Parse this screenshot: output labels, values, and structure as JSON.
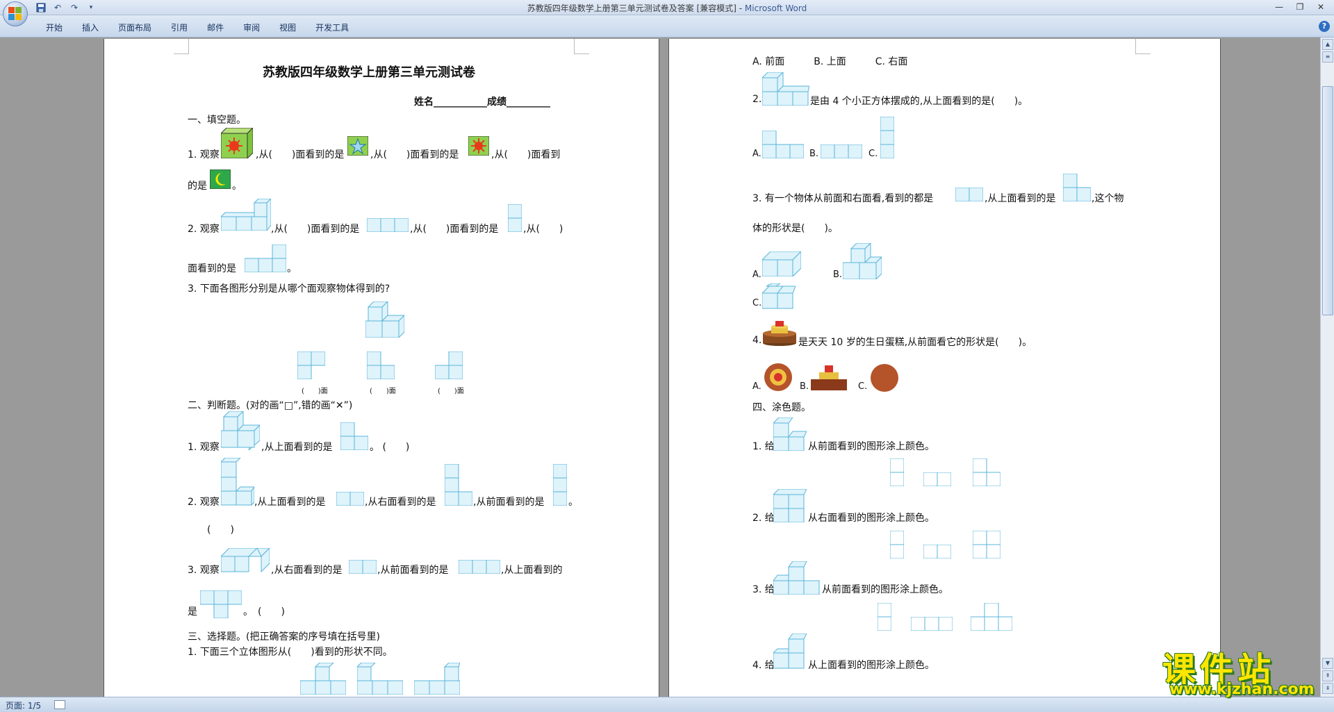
{
  "window": {
    "title_doc": "苏教版四年级数学上册第三单元测试卷及答案 [兼容模式] - ",
    "title_app": "Microsoft Word"
  },
  "ribbon": {
    "tabs": [
      "开始",
      "插入",
      "页面布局",
      "引用",
      "邮件",
      "审阅",
      "视图",
      "开发工具"
    ]
  },
  "status": {
    "page": "页面: 1/5"
  },
  "watermark": {
    "brand": "课件站",
    "url": "www.kjzhan.com"
  },
  "colors": {
    "cube_fill": "#dff3fb",
    "cube_stroke": "#5ab4d8",
    "accent": "#2f6fc2"
  },
  "left_page": {
    "title": "苏教版四年级数学上册第三单元测试卷",
    "name_score": "姓名___________成绩_________",
    "s1": "一、填空题。",
    "q1_a": "1. 观察",
    "q1_b": ",从(　　)面看到的是",
    "q1_c": ",从(　　)面看到的是",
    "q1_d": ",从(　　)面看到",
    "q1_e": "的是",
    "q1_f": "。",
    "q2_a": "2. 观察",
    "q2_b": ",从(　　)面看到的是",
    "q2_c": ",从(　　)面看到的是",
    "q2_d": ",从(　　)",
    "q2_e": "面看到的是",
    "q2_f": "。",
    "q3": "3. 下面各图形分别是从哪个面观察物体得到的?",
    "q3_paren": "(　　)面",
    "s2": "二、判断题。(对的画“□”,错的画“✕”)",
    "j1_a": "1. 观察",
    "j1_b": ",从上面看到的是",
    "j1_c": "。 (　　)",
    "j2_a": "2. 观察",
    "j2_b": ",从上面看到的是",
    "j2_c": ",从右面看到的是",
    "j2_d": ",从前面看到的是",
    "j2_e": "。",
    "j2_f": "(　　)",
    "j3_a": "3. 观察",
    "j3_b": ",从右面看到的是",
    "j3_c": ",从前面看到的是",
    "j3_d": ",从上面看到的",
    "j3_e": "是",
    "j3_f": "。　(　　)",
    "s3": "三、选择题。(把正确答案的序号填在括号里)",
    "c1": "1. 下面三个立体图形从(　　)看到的形状不同。"
  },
  "right_page": {
    "c1_opts": "A. 前面　　　B. 上面　　　C. 右面",
    "c2_a": "2.",
    "c2_b": "是由 4 个小正方体摆成的,从上面看到的是(　　)。",
    "c3_a": "3. 有一个物体从前面和右面看,看到的都是",
    "c3_b": ",从上面看到的是",
    "c3_c": ",这个物",
    "c3_d": "体的形状是(　　)。",
    "c4_a": "4.",
    "c4_b": "是天天 10 岁的生日蛋糕,从前面看它的形状是(　　)。",
    "s4": "四、涂色题。",
    "p1_a": "1. 给",
    "p1_b": "从前面看到的图形涂上颜色。",
    "p2_a": "2. 给",
    "p2_b": "从右面看到的图形涂上颜色。",
    "p3_a": "3. 给",
    "p3_b": "从前面看到的图形涂上颜色。",
    "p4_a": "4. 给",
    "p4_b": "从上面看到的图形涂上颜色。",
    "opt_a": "A.",
    "opt_b": "B.",
    "opt_c": "C."
  }
}
